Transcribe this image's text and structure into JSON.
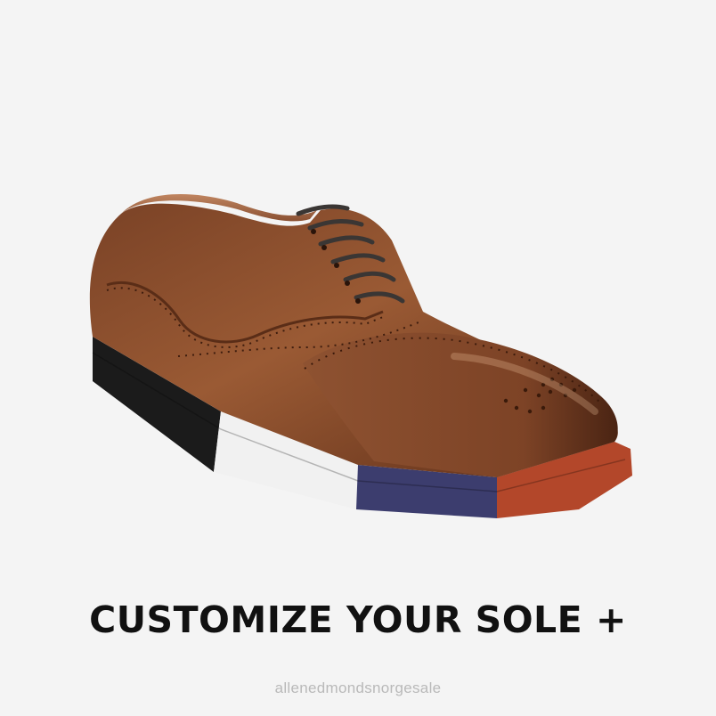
{
  "product": {
    "icon": "brogue-oxford-shoe",
    "upper_color": "#8a4e2c",
    "sole_colors": [
      "#1b1b1b",
      "#f1f1f1",
      "#3c3d6e",
      "#b3472a"
    ]
  },
  "headline": "CUSTOMIZE YOUR SOLE +",
  "watermark": "allenedmondsnorgesale"
}
